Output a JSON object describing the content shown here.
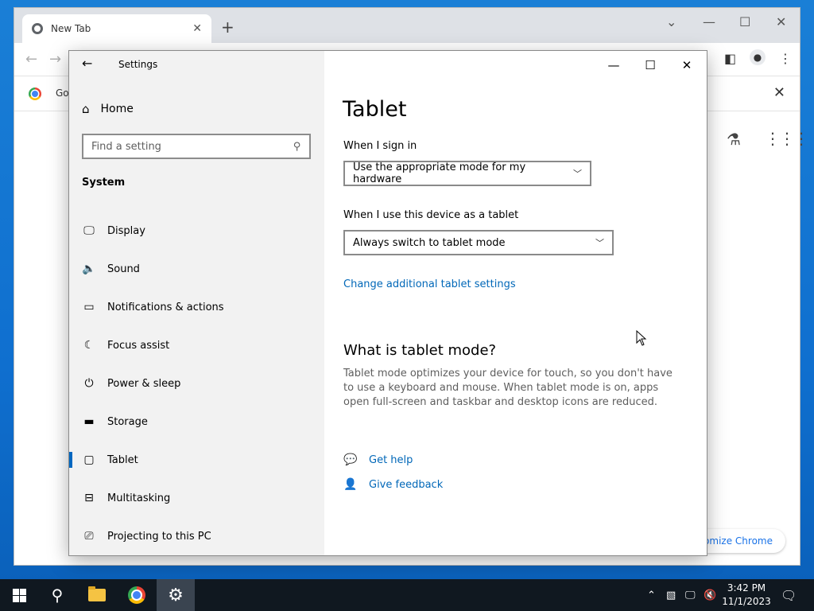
{
  "chrome": {
    "tab_title": "New Tab",
    "tab_close": "✕",
    "new_tab": "+",
    "infobar_text": "Go",
    "infobar_close": "✕",
    "customize_label": "tomize Chrome"
  },
  "settings": {
    "window_title": "Settings",
    "minimize": "—",
    "maximize": "☐",
    "close": "✕",
    "back": "←",
    "home_label": "Home",
    "search_placeholder": "Find a setting",
    "section_label": "System",
    "nav": [
      {
        "label": "Display",
        "icon": "display-icon"
      },
      {
        "label": "Sound",
        "icon": "sound-icon"
      },
      {
        "label": "Notifications & actions",
        "icon": "notifications-icon"
      },
      {
        "label": "Focus assist",
        "icon": "moon-icon"
      },
      {
        "label": "Power & sleep",
        "icon": "power-icon"
      },
      {
        "label": "Storage",
        "icon": "storage-icon"
      },
      {
        "label": "Tablet",
        "icon": "tablet-icon",
        "active": true
      },
      {
        "label": "Multitasking",
        "icon": "multitasking-icon"
      },
      {
        "label": "Projecting to this PC",
        "icon": "projecting-icon"
      }
    ],
    "page_title": "Tablet",
    "sign_in_label": "When I sign in",
    "sign_in_value": "Use the appropriate mode for my hardware",
    "tablet_use_label": "When I use this device as a tablet",
    "tablet_use_value": "Always switch to tablet mode",
    "additional_link": "Change additional tablet settings",
    "what_title": "What is tablet mode?",
    "what_desc": "Tablet mode optimizes your device for touch, so you don't have to use a keyboard and mouse. When tablet mode is on, apps open full-screen and taskbar and desktop icons are reduced.",
    "get_help": "Get help",
    "give_feedback": "Give feedback"
  },
  "taskbar": {
    "time": "3:42 PM",
    "date": "11/1/2023"
  },
  "colors": {
    "accent": "#0067c0",
    "link": "#0067b8",
    "sidebar_bg": "#f2f2f2",
    "taskbar_bg": "#101820"
  }
}
